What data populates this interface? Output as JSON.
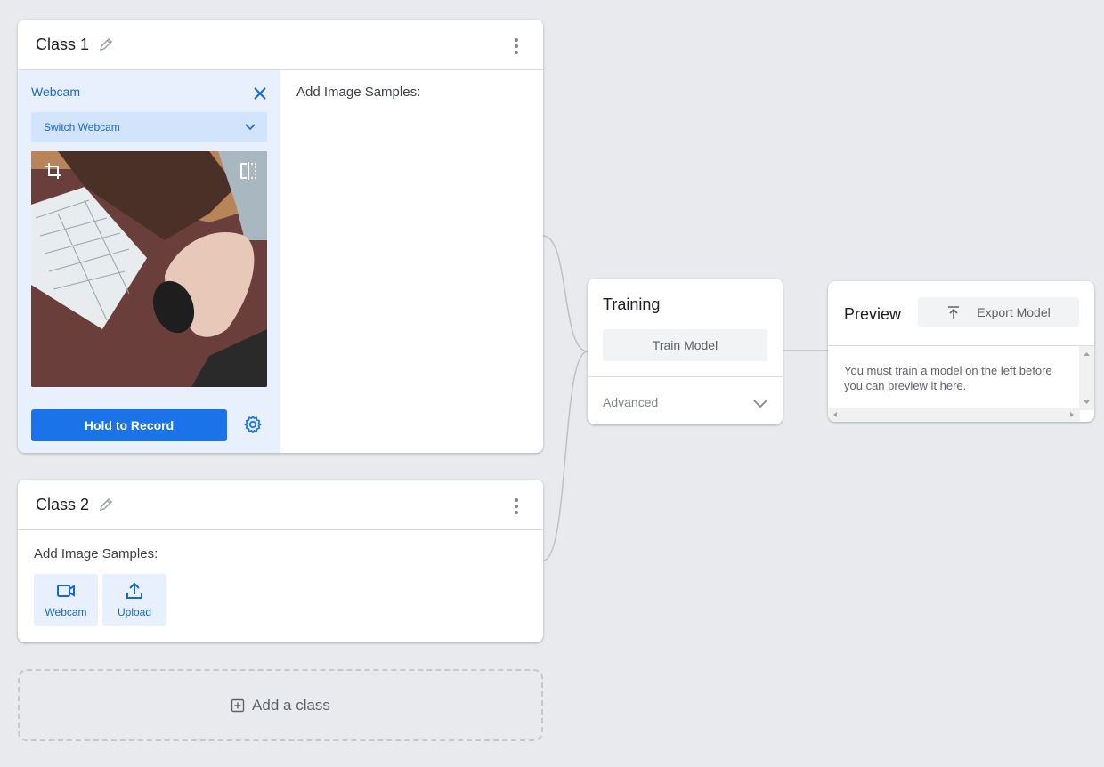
{
  "class1": {
    "title": "Class 1",
    "webcam_title": "Webcam",
    "switch_label": "Switch Webcam",
    "record_label": "Hold to Record",
    "samples_label": "Add Image Samples:"
  },
  "class2": {
    "title": "Class 2",
    "samples_label": "Add Image Samples:",
    "webcam_label": "Webcam",
    "upload_label": "Upload"
  },
  "add_class_label": "Add a class",
  "training": {
    "title": "Training",
    "train_label": "Train Model",
    "advanced_label": "Advanced"
  },
  "preview": {
    "title": "Preview",
    "export_label": "Export Model",
    "message": "You must train a model on the left before you can preview it here."
  },
  "colors": {
    "accent": "#1a73e8",
    "accent_text": "#1967d2",
    "light_blue": "#e8f0fe",
    "background": "#e8eaed"
  }
}
